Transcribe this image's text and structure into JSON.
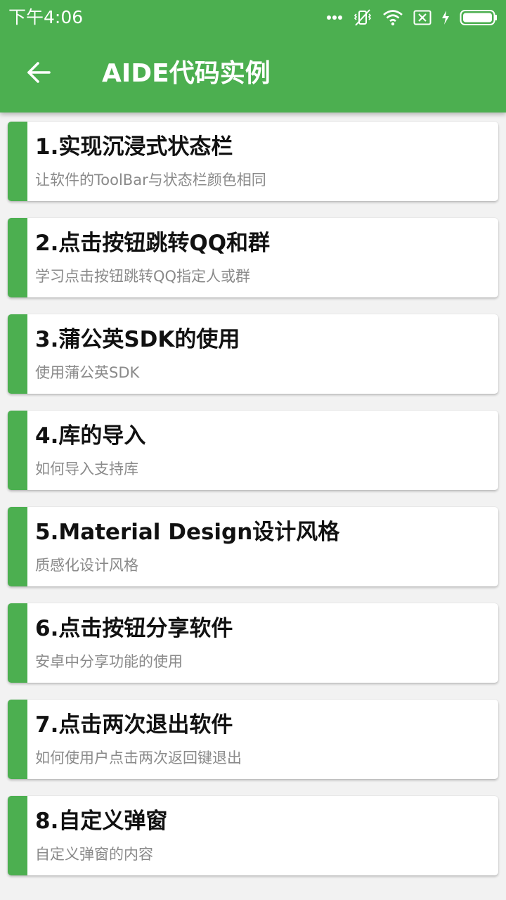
{
  "status_bar": {
    "time": "下午4:06",
    "icons": [
      "more-dots-icon",
      "vibrate-off-icon",
      "wifi-icon",
      "sim-none-icon",
      "charging-icon",
      "battery-icon"
    ]
  },
  "toolbar": {
    "back_icon": "arrow-back-icon",
    "title": "AIDE代码实例"
  },
  "colors": {
    "primary": "#4caf50",
    "background": "#f2f2f2",
    "card": "#ffffff",
    "title_text": "#111111",
    "subtitle_text": "#8a8a8a"
  },
  "items": [
    {
      "title": "1.实现沉浸式状态栏",
      "subtitle": "让软件的ToolBar与状态栏颜色相同"
    },
    {
      "title": "2.点击按钮跳转QQ和群",
      "subtitle": "学习点击按钮跳转QQ指定人或群"
    },
    {
      "title": "3.蒲公英SDK的使用",
      "subtitle": "使用蒲公英SDK"
    },
    {
      "title": "4.库的导入",
      "subtitle": "如何导入支持库"
    },
    {
      "title": "5.Material Design设计风格",
      "subtitle": "质感化设计风格"
    },
    {
      "title": "6.点击按钮分享软件",
      "subtitle": "安卓中分享功能的使用"
    },
    {
      "title": "7.点击两次退出软件",
      "subtitle": "如何使用户点击两次返回键退出"
    },
    {
      "title": "8.自定义弹窗",
      "subtitle": "自定义弹窗的内容"
    }
  ]
}
